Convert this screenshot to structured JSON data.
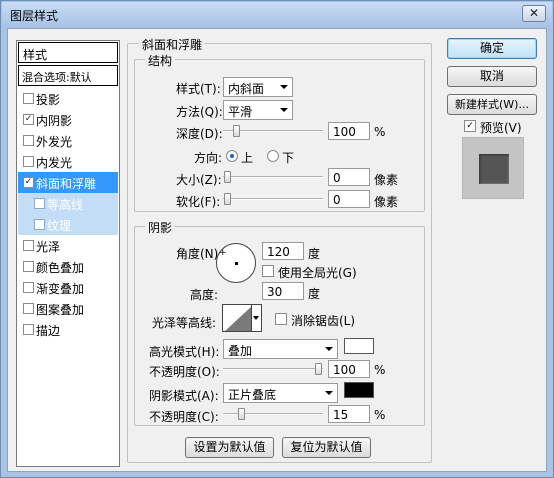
{
  "window": {
    "title": "图层样式",
    "close_glyph": "✕"
  },
  "sidebar": {
    "header": "样式",
    "blend_options": "混合选项:默认",
    "items": [
      {
        "label": "投影",
        "checked": false
      },
      {
        "label": "内阴影",
        "checked": true
      },
      {
        "label": "外发光",
        "checked": false
      },
      {
        "label": "内发光",
        "checked": false
      },
      {
        "label": "斜面和浮雕",
        "checked": true
      },
      {
        "label": "等高线",
        "checked": false
      },
      {
        "label": "纹理",
        "checked": false
      },
      {
        "label": "光泽",
        "checked": false
      },
      {
        "label": "颜色叠加",
        "checked": false
      },
      {
        "label": "渐变叠加",
        "checked": false
      },
      {
        "label": "图案叠加",
        "checked": false
      },
      {
        "label": "描边",
        "checked": false
      }
    ],
    "check_glyph": "✓"
  },
  "bevel": {
    "group_title": "斜面和浮雕",
    "structure": {
      "title": "结构",
      "style_label": "样式(T):",
      "style_value": "内斜面",
      "technique_label": "方法(Q):",
      "technique_value": "平滑",
      "depth_label": "深度(D):",
      "depth_value": "100",
      "depth_unit": "%",
      "depth_level": 0.1,
      "direction_label": "方向:",
      "dir_up": "上",
      "dir_down": "下",
      "size_label": "大小(Z):",
      "size_value": "0",
      "size_unit": "像素",
      "size_level": 0,
      "soften_label": "软化(F):",
      "soften_value": "0",
      "soften_unit": "像素",
      "soften_level": 0
    },
    "shading": {
      "title": "阴影",
      "angle_label": "角度(N):",
      "angle_value": "120",
      "angle_unit": "度",
      "global_light_label": "使用全局光(G)",
      "global_light_checked": false,
      "altitude_label": "高度:",
      "altitude_value": "30",
      "altitude_unit": "度",
      "gloss_label": "光泽等高线:",
      "antialias_label": "消除锯齿(L)",
      "highlight_mode_label": "高光模式(H):",
      "highlight_mode_value": "叠加",
      "highlight_color": "#ffffff",
      "highlight_opacity_label": "不透明度(O):",
      "highlight_opacity_value": "100",
      "highlight_opacity_unit": "%",
      "highlight_opacity_level": 1.0,
      "shadow_mode_label": "阴影模式(A):",
      "shadow_mode_value": "正片叠底",
      "shadow_color": "#000000",
      "shadow_opacity_label": "不透明度(C):",
      "shadow_opacity_value": "15",
      "shadow_opacity_unit": "%",
      "shadow_opacity_level": 0.15
    },
    "make_default": "设置为默认值",
    "reset_default": "复位为默认值"
  },
  "actions": {
    "ok": "确定",
    "cancel": "取消",
    "new_style": "新建样式(W)...",
    "preview_label": "预览(V)",
    "preview_checked": true
  }
}
